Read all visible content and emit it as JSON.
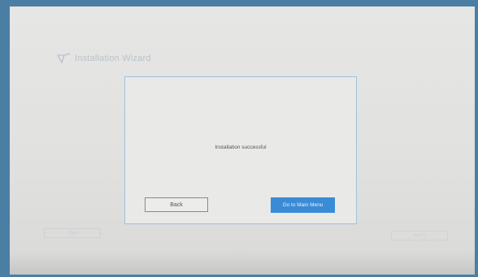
{
  "wizard": {
    "title": "Installation Wizard",
    "logo_icon": "wizard-logo-icon"
  },
  "dialog": {
    "message": "Installation successful",
    "back_label": "Back",
    "main_menu_label": "Go to Main Menu"
  },
  "background_buttons": {
    "back_label": "< Back",
    "next_label": "Next >"
  },
  "colors": {
    "frame": "#4a7fa3",
    "dialog_border": "#9fc2dc",
    "primary_button": "#3a8bd6"
  }
}
